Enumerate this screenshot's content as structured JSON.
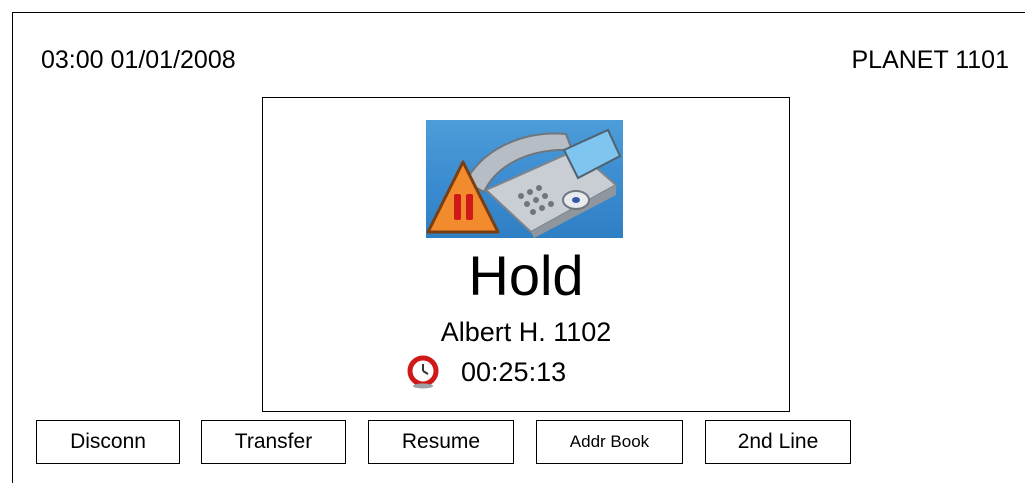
{
  "status_bar": {
    "datetime": "03:00 01/01/2008",
    "device_name": "PLANET 1101"
  },
  "call": {
    "state": "Hold",
    "caller": "Albert H. 1102",
    "duration": "00:25:13",
    "image_icon": "phone-on-hold-icon",
    "timer_icon": "alarm-clock-icon"
  },
  "softkeys": [
    {
      "label": "Disconn"
    },
    {
      "label": "Transfer"
    },
    {
      "label": "Resume"
    },
    {
      "label": "Addr Book"
    },
    {
      "label": "2nd Line"
    }
  ],
  "colors": {
    "image_bg": "#3a8bd0",
    "warning_orange": "#f28a2e",
    "pause_red": "#d01818",
    "clock_red": "#d01818"
  }
}
